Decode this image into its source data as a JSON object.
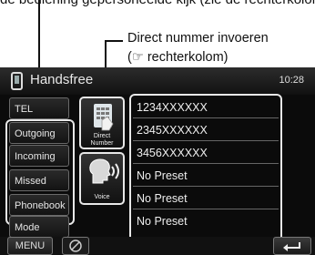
{
  "top_caption": "de bediening gepersoneelde kijk (zie de rechterkolom)",
  "callout": {
    "line1": "Direct nummer invoeren",
    "line2": "(☞ rechterkolom)"
  },
  "app": {
    "title": "Handsfree",
    "time": "10:28"
  },
  "sidebar": {
    "top_label": "TEL",
    "items": [
      {
        "label": "Outgoing"
      },
      {
        "label": "Incoming"
      },
      {
        "label": "Missed"
      },
      {
        "label": "Phonebook"
      }
    ],
    "mode_label": "Mode"
  },
  "middle": {
    "direct_label_1": "Direct",
    "direct_label_2": "Number",
    "voice_label": "Voice"
  },
  "presets": [
    {
      "label": "1234XXXXXX"
    },
    {
      "label": "2345XXXXXX"
    },
    {
      "label": "3456XXXXXX"
    },
    {
      "label": "No Preset"
    },
    {
      "label": "No Preset"
    },
    {
      "label": "No Preset"
    }
  ],
  "bottom": {
    "menu_label": "MENU"
  },
  "colors": {
    "screen_bg": "#0b0b0b",
    "highlight_frame": "#e8e8e8"
  }
}
